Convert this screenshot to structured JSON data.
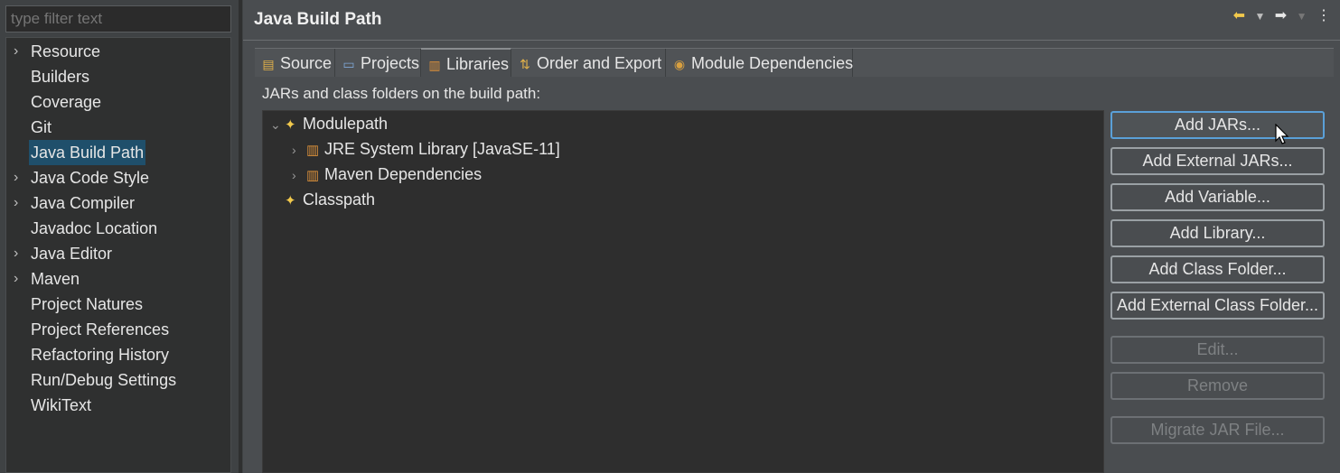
{
  "filter": {
    "placeholder": "type filter text"
  },
  "nav": {
    "items": [
      {
        "label": "Resource",
        "expandable": true
      },
      {
        "label": "Builders",
        "expandable": false
      },
      {
        "label": "Coverage",
        "expandable": false
      },
      {
        "label": "Git",
        "expandable": false
      },
      {
        "label": "Java Build Path",
        "expandable": false,
        "selected": true
      },
      {
        "label": "Java Code Style",
        "expandable": true
      },
      {
        "label": "Java Compiler",
        "expandable": true
      },
      {
        "label": "Javadoc Location",
        "expandable": false
      },
      {
        "label": "Java Editor",
        "expandable": true
      },
      {
        "label": "Maven",
        "expandable": true
      },
      {
        "label": "Project Natures",
        "expandable": false
      },
      {
        "label": "Project References",
        "expandable": false
      },
      {
        "label": "Refactoring History",
        "expandable": false
      },
      {
        "label": "Run/Debug Settings",
        "expandable": false
      },
      {
        "label": "WikiText",
        "expandable": false
      }
    ]
  },
  "page": {
    "title": "Java Build Path"
  },
  "tabs": [
    {
      "label": "Source",
      "icon": "source-folder-icon"
    },
    {
      "label": "Projects",
      "icon": "projects-icon"
    },
    {
      "label": "Libraries",
      "icon": "libraries-icon",
      "active": true
    },
    {
      "label": "Order and Export",
      "icon": "order-export-icon"
    },
    {
      "label": "Module Dependencies",
      "icon": "module-icon"
    }
  ],
  "libraries": {
    "description": "JARs and class folders on the build path:",
    "tree": [
      {
        "label": "Modulepath",
        "expanded": true
      },
      {
        "label": "JRE System Library [JavaSE-11]"
      },
      {
        "label": "Maven Dependencies"
      },
      {
        "label": "Classpath"
      }
    ]
  },
  "buttons": [
    {
      "label": "Add JARs...",
      "enabled": true
    },
    {
      "label": "Add External JARs...",
      "enabled": true
    },
    {
      "label": "Add Variable...",
      "enabled": true
    },
    {
      "label": "Add Library...",
      "enabled": true
    },
    {
      "label": "Add Class Folder...",
      "enabled": true
    },
    {
      "label": "Add External Class Folder...",
      "enabled": true
    },
    {
      "label": "Edit...",
      "enabled": false
    },
    {
      "label": "Remove",
      "enabled": false
    },
    {
      "label": "Migrate JAR File...",
      "enabled": false
    }
  ]
}
